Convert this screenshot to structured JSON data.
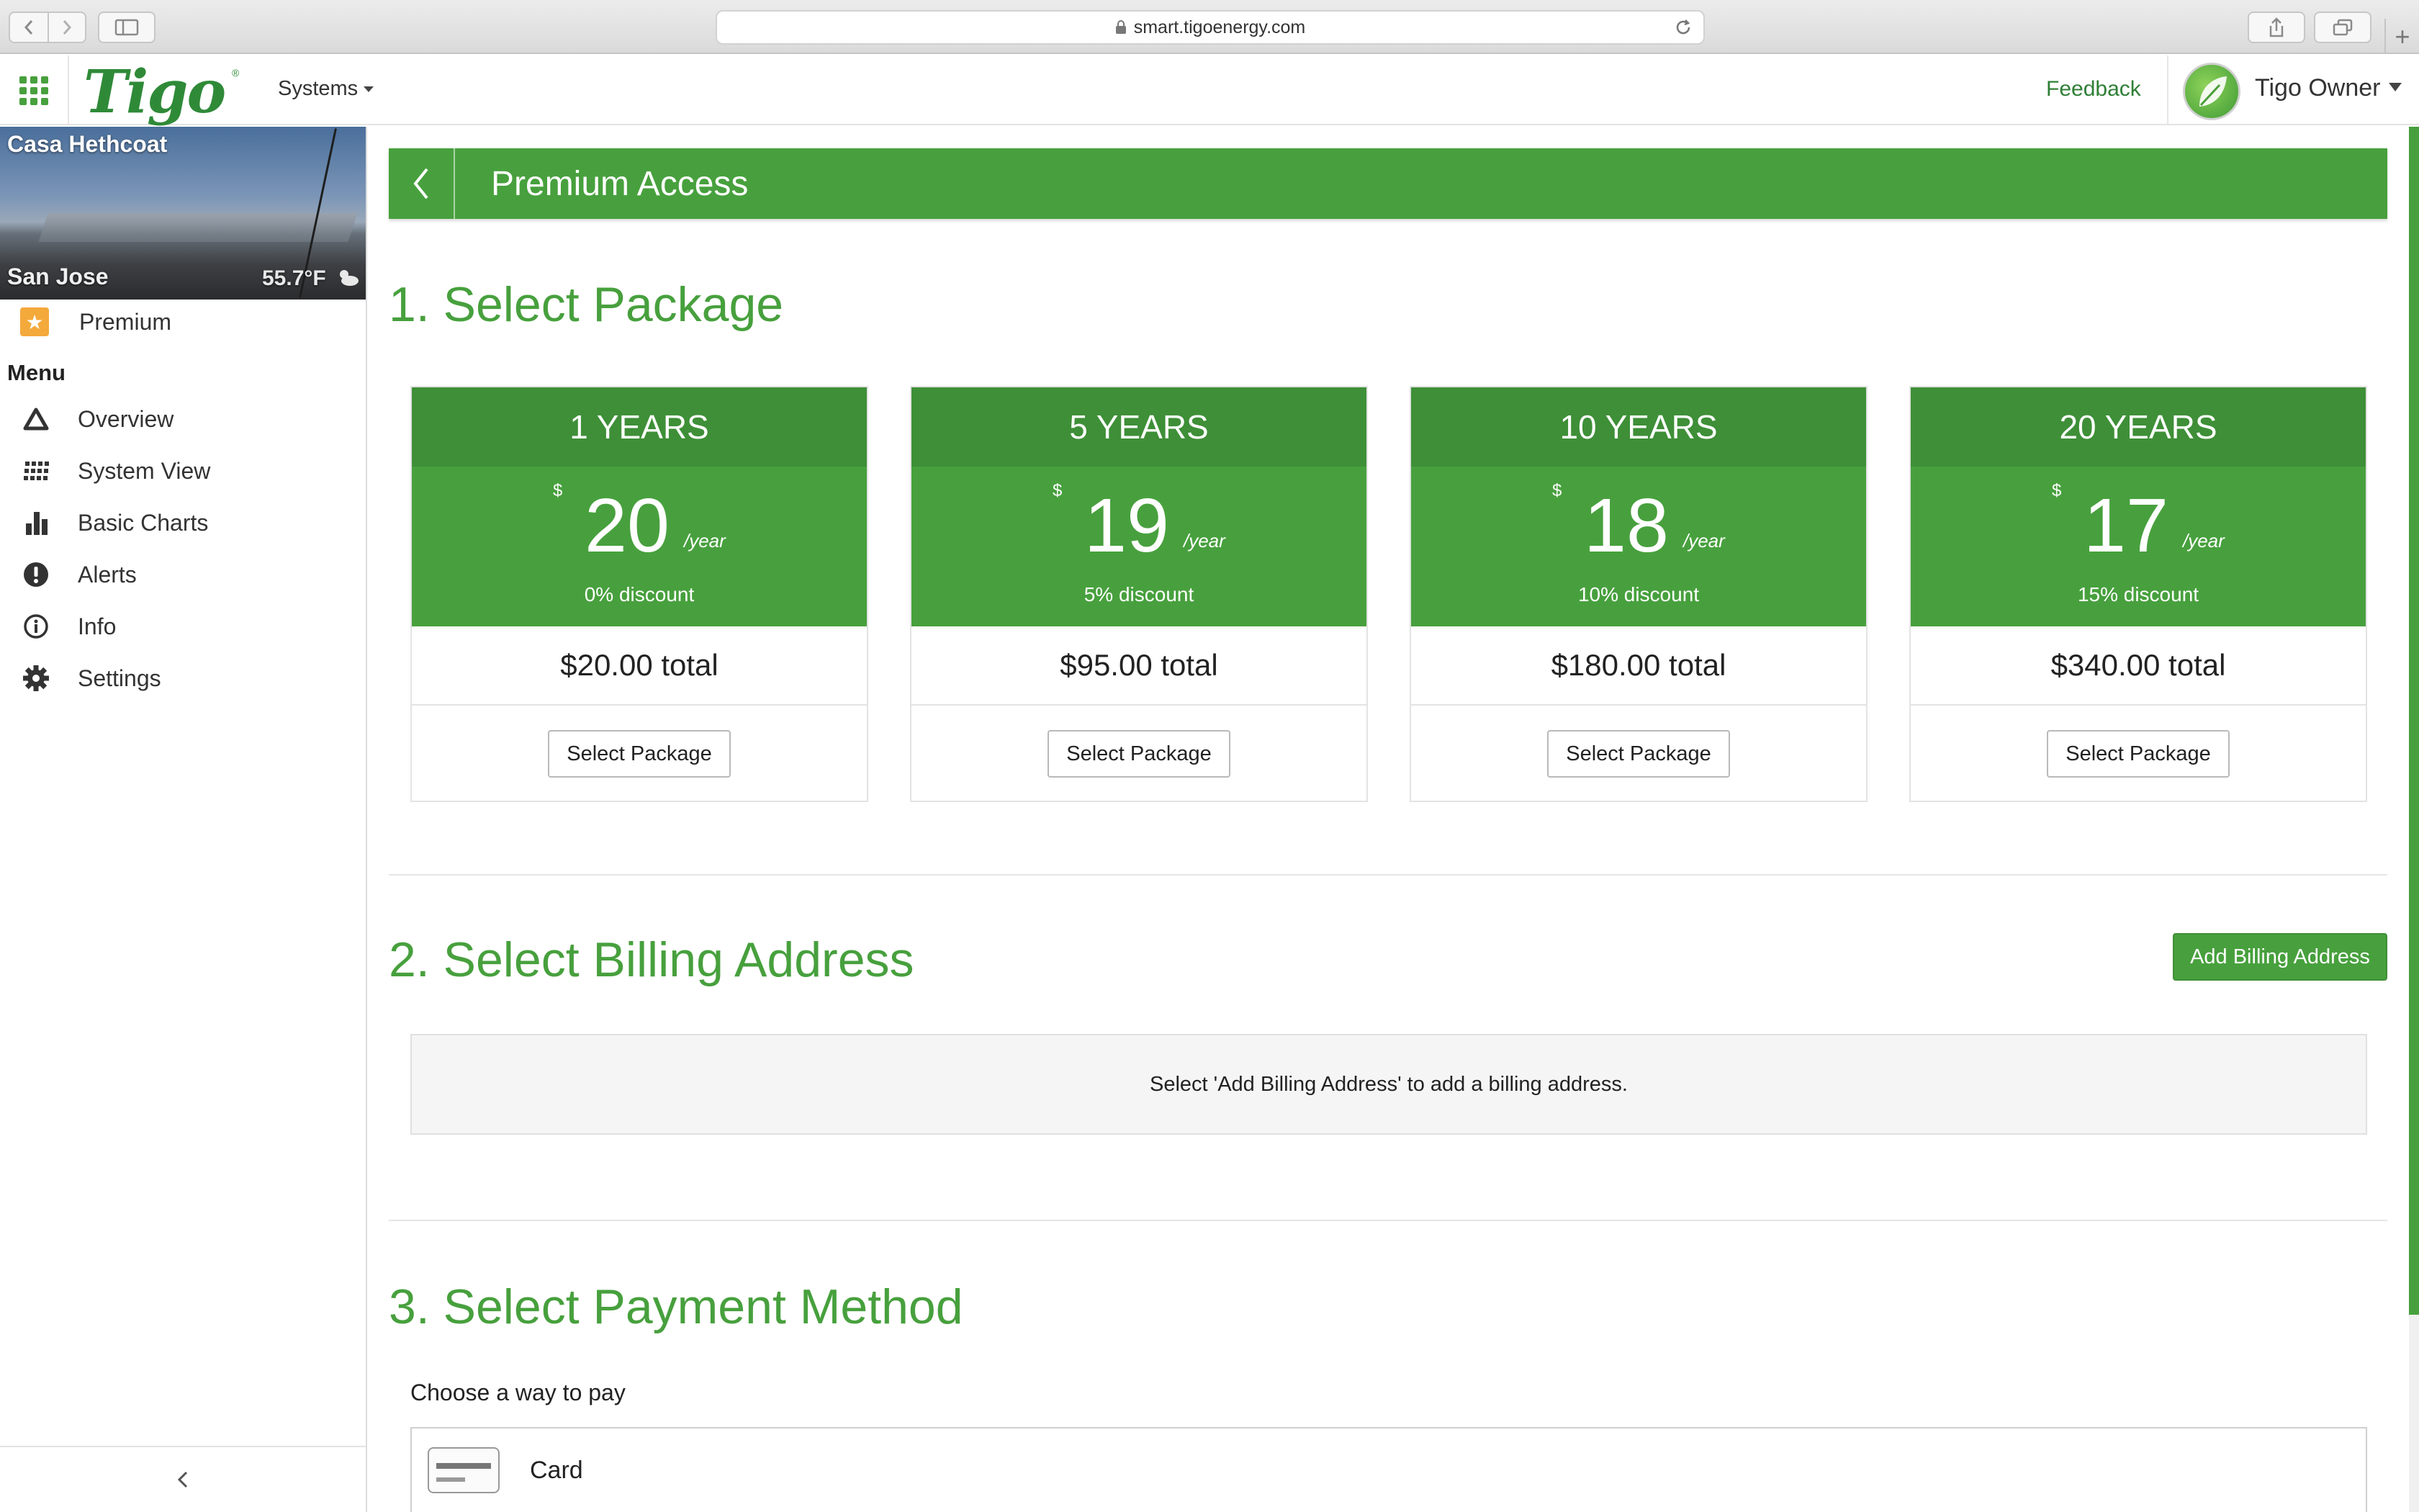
{
  "browser": {
    "url": "smart.tigoenergy.com"
  },
  "header": {
    "logo": "Tigo",
    "logo_mark": "®",
    "systems_label": "Systems",
    "feedback_label": "Feedback",
    "user_name": "Tigo Owner"
  },
  "sidebar": {
    "site_name": "Casa Hethcoat",
    "site_city": "San Jose",
    "site_temp": "55.7°F",
    "premium_label": "Premium",
    "menu_title": "Menu",
    "items": [
      {
        "label": "Overview",
        "icon": "triangle-icon"
      },
      {
        "label": "System View",
        "icon": "grid-icon"
      },
      {
        "label": "Basic Charts",
        "icon": "bar-chart-icon"
      },
      {
        "label": "Alerts",
        "icon": "alert-icon"
      },
      {
        "label": "Info",
        "icon": "info-icon"
      },
      {
        "label": "Settings",
        "icon": "gear-icon"
      }
    ]
  },
  "page": {
    "title": "Premium Access",
    "section1_title": "1. Select Package",
    "section2_title": "2. Select Billing Address",
    "section3_title": "3. Select Payment Method",
    "add_billing_label": "Add Billing Address",
    "billing_empty_text": "Select 'Add Billing Address' to add a billing address.",
    "choose_pay_label": "Choose a way to pay",
    "payment_option_card": "Card"
  },
  "packages": [
    {
      "term": "1 YEARS",
      "currency": "$",
      "price": "20",
      "per": "/year",
      "discount": "0% discount",
      "total": "$20.00 total",
      "button": "Select Package"
    },
    {
      "term": "5 YEARS",
      "currency": "$",
      "price": "19",
      "per": "/year",
      "discount": "5% discount",
      "total": "$95.00 total",
      "button": "Select Package"
    },
    {
      "term": "10 YEARS",
      "currency": "$",
      "price": "18",
      "per": "/year",
      "discount": "10% discount",
      "total": "$180.00 total",
      "button": "Select Package"
    },
    {
      "term": "20 YEARS",
      "currency": "$",
      "price": "17",
      "per": "/year",
      "discount": "15% discount",
      "total": "$340.00 total",
      "button": "Select Package"
    }
  ],
  "colors": {
    "brand_green": "#47a03d",
    "header_green_dark": "#3e8f37",
    "premium_star": "#f4a93b"
  }
}
